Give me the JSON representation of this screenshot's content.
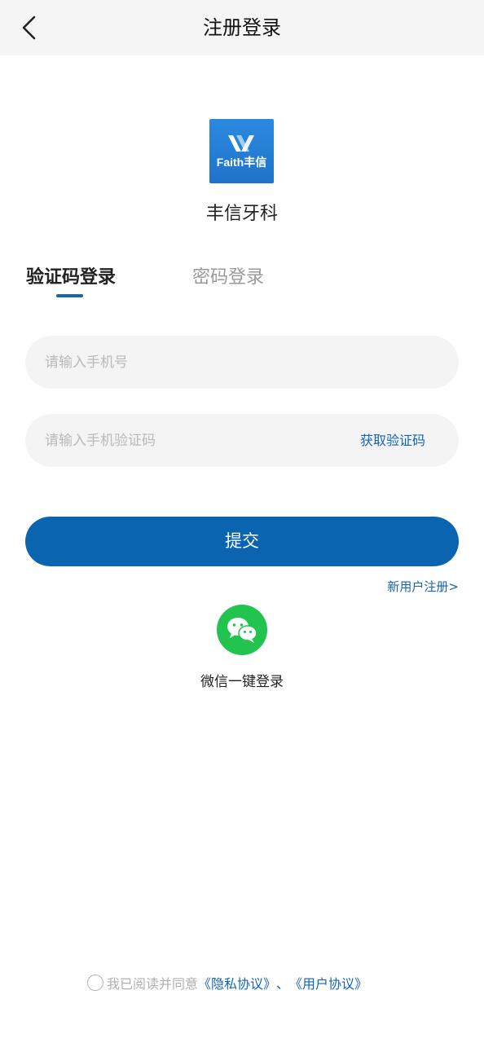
{
  "header": {
    "title": "注册登录",
    "back_icon": "chevron-left-icon"
  },
  "brand": {
    "logo_text": "Faith丰信",
    "app_name": "丰信牙科",
    "logo_color": "#1f73c9"
  },
  "tabs": [
    {
      "label": "验证码登录",
      "active": true
    },
    {
      "label": "密码登录",
      "active": false
    }
  ],
  "form": {
    "phone": {
      "placeholder": "请输入手机号",
      "value": ""
    },
    "code": {
      "placeholder": "请输入手机验证码",
      "value": ""
    },
    "get_code_label": "获取验证码",
    "submit_label": "提交"
  },
  "register_link": "新用户注册>",
  "wechat": {
    "icon": "wechat-icon",
    "label": "微信一键登录",
    "color": "#22c44f"
  },
  "agreement": {
    "prefix": "我已阅读并同意",
    "privacy": "《隐私协议》",
    "separator": "、",
    "user": "《用户协议》",
    "checked": false
  },
  "colors": {
    "accent": "#0a64b0",
    "header_bg": "#f5f5f5",
    "field_bg": "#f4f4f4"
  }
}
